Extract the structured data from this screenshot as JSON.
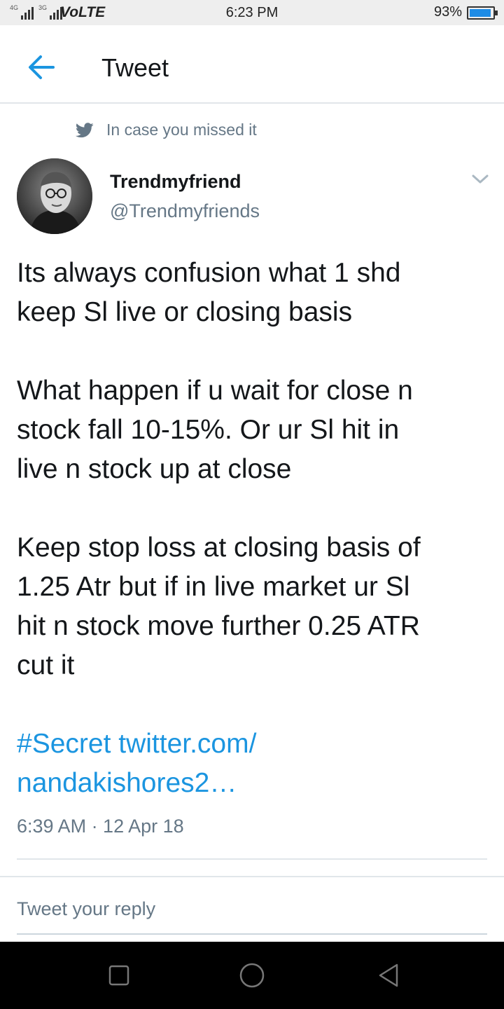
{
  "status_bar": {
    "network_tags": [
      "4G",
      "3G"
    ],
    "volte_label": "VoLTE",
    "time": "6:23 PM",
    "battery_percent_label": "93%",
    "battery_level": 0.93,
    "battery_color": "#1e8ce6"
  },
  "header": {
    "back_icon": "arrow-left-icon",
    "title": "Tweet"
  },
  "context": {
    "icon": "twitter-bird-icon",
    "label": "In case you missed it"
  },
  "author": {
    "name": "Trendmyfriend",
    "handle": "@Trendmyfriends"
  },
  "tweet": {
    "paragraphs": [
      "Its always confusion what 1 shd\nkeep Sl live or closing basis",
      "What happen if u wait for close n\nstock fall 10-15%. Or ur Sl hit in\nlive n stock up at close",
      "Keep stop loss at closing basis of\n1.25 Atr but if in live market ur Sl\nhit n stock move further 0.25 ATR\ncut it"
    ],
    "link_text": "#Secret twitter.com/\nnandakishores2…",
    "timestamp": "6:39 AM · 12 Apr 18"
  },
  "reply": {
    "placeholder": "Tweet your reply"
  },
  "colors": {
    "accent": "#1b95e0",
    "secondary_text": "#657786",
    "primary_text": "#14171a"
  },
  "navbar": {
    "buttons": [
      "recents-square-icon",
      "home-circle-icon",
      "back-triangle-icon"
    ]
  }
}
